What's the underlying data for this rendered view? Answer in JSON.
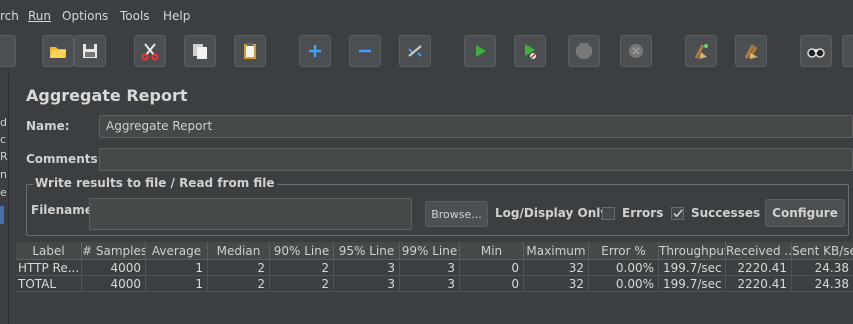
{
  "menu": {
    "items": [
      "rch",
      "Run",
      "Options",
      "Tools",
      "Help"
    ]
  },
  "toolbar": {
    "buttons": [
      "folder-open-icon",
      "save-icon",
      "cut-icon",
      "copy-icon",
      "paste-icon",
      "add-icon",
      "remove-icon",
      "toggle-icon",
      "start-icon",
      "start-no-pause-icon",
      "stop-icon",
      "shutdown-icon",
      "clear-icon",
      "clear-all-icon",
      "search-icon"
    ]
  },
  "left_strip": {
    "chars": [
      "d",
      "c",
      "R",
      "n",
      "e"
    ]
  },
  "panel": {
    "title": "Aggregate Report",
    "name_label": "Name:",
    "name_value": "Aggregate Report",
    "comments_label": "Comments:",
    "comments_value": "",
    "file_group_legend": "Write results to file / Read from file",
    "filename_label": "Filename",
    "filename_value": "",
    "browse_label": "Browse...",
    "log_display_label": "Log/Display Only:",
    "errors_label": "Errors",
    "errors_checked": false,
    "successes_label": "Successes",
    "successes_checked": true,
    "configure_label": "Configure"
  },
  "table": {
    "columns": [
      "Label",
      "# Samples",
      "Average",
      "Median",
      "90% Line",
      "95% Line",
      "99% Line",
      "Min",
      "Maximum",
      "Error %",
      "Throughput",
      "Received ...",
      "Sent KB/sec"
    ],
    "rows": [
      [
        "HTTP Re...",
        "4000",
        "1",
        "2",
        "2",
        "3",
        "3",
        "0",
        "32",
        "0.00%",
        "199.7/sec",
        "2220.41",
        "24.38"
      ],
      [
        "TOTAL",
        "4000",
        "1",
        "2",
        "2",
        "3",
        "3",
        "0",
        "32",
        "0.00%",
        "199.7/sec",
        "2220.41",
        "24.38"
      ]
    ]
  },
  "colors": {
    "background": "#3c3f41",
    "field": "#45494a",
    "border": "#5e6060",
    "play": "#3bb33b"
  }
}
